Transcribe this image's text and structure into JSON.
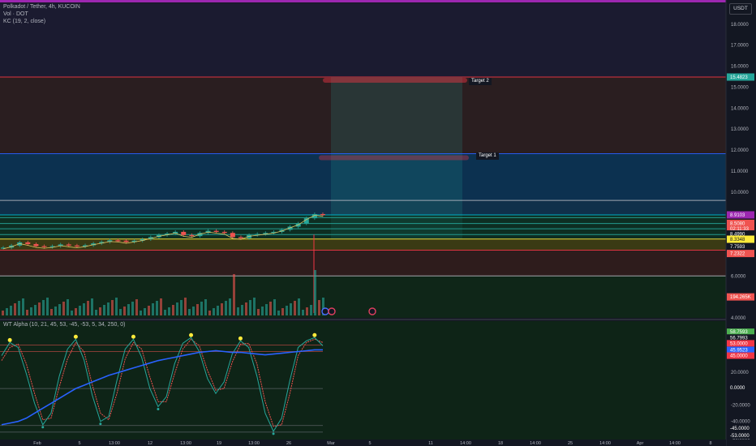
{
  "header": {
    "symbol_line": "Polkadot / Tether, 4h, KUCOIN",
    "volume_line": "Vol · DOT",
    "kc_line": "KC (19, 2, close)",
    "currency": "USDT"
  },
  "osc_legend": "WT Alpha (10, 21, 45, 53, -45, -53, 5, 34, 250, 0)",
  "targets": {
    "t2": "Target 2",
    "t1": "Target 1"
  },
  "colors": {
    "background": "#131722",
    "up": "#26a69a",
    "down": "#ef5350",
    "purple": "#9c27b0",
    "yellow": "#ffeb3b",
    "blue": "#2962ff",
    "cyan": "#00bcd4"
  },
  "chart_data": [
    {
      "type": "candlestick",
      "title": "Polkadot / Tether, 4h, KUCOIN",
      "ylim": [
        4.0,
        19.0
      ],
      "y_ticks": [
        "4.0000",
        "6.0000",
        "10.0000",
        "11.0000",
        "12.0000",
        "13.0000",
        "14.0000",
        "15.0000",
        "16.0000",
        "17.0000",
        "18.0000"
      ],
      "x_ticks": [
        "Feb",
        "5",
        "13:00",
        "12",
        "13:00",
        "19",
        "13:00",
        "26",
        "Mar",
        "5",
        "11",
        "14:00",
        "18",
        "14:00",
        "25",
        "14:00",
        "Apr",
        "14:00",
        "8"
      ],
      "price_labels": [
        {
          "text": "15.4823",
          "color": "#26a69a",
          "value": 15.4823
        },
        {
          "text": "8.9103",
          "color": "#9c27b0",
          "value": 8.9103
        },
        {
          "text": "8.5080",
          "color": "#ef5350",
          "value": 8.508
        },
        {
          "text": "02:11:33",
          "color": "#ef5350",
          "value": 8.25
        },
        {
          "text": "8.4990",
          "color": "#131722",
          "value": 8.0
        },
        {
          "text": "8.3348",
          "color": "#ffeb3b",
          "value": 7.75
        },
        {
          "text": "7.7593",
          "color": "#131722",
          "value": 7.4
        },
        {
          "text": "7.2322",
          "color": "#ef5350",
          "value": 7.07
        },
        {
          "text": "194.265K",
          "color": "#ef5350",
          "value": 5.0
        }
      ],
      "levels": [
        {
          "value": 15.48,
          "color": "#f23645"
        },
        {
          "value": 11.83,
          "color": "#2962ff"
        },
        {
          "value": 9.6,
          "color": "#b2b5be"
        },
        {
          "value": 8.91,
          "color": "#00bcd4"
        },
        {
          "value": 8.78,
          "color": "#26a69a"
        },
        {
          "value": 8.5,
          "color": "#26a69a"
        },
        {
          "value": 8.25,
          "color": "#26a69a"
        },
        {
          "value": 7.97,
          "color": "#26a69a"
        },
        {
          "value": 7.76,
          "color": "#ffeb3b"
        },
        {
          "value": 7.23,
          "color": "#f23645"
        },
        {
          "value": 6.0,
          "color": "#b2b5be"
        }
      ],
      "price_series": [
        7.35,
        7.45,
        7.6,
        7.52,
        7.42,
        7.38,
        7.42,
        7.5,
        7.45,
        7.4,
        7.46,
        7.55,
        7.62,
        7.7,
        7.68,
        7.62,
        7.68,
        7.75,
        7.85,
        7.95,
        8.02,
        8.1,
        7.95,
        7.9,
        8.05,
        8.15,
        8.1,
        8.05,
        7.85,
        7.8,
        7.95,
        8.0,
        8.05,
        8.1,
        8.2,
        8.35,
        8.5,
        8.75,
        8.95,
        8.9
      ]
    },
    {
      "type": "line",
      "title": "WT Alpha (10, 21, 45, 53, -45, -53, 5, 34, 250, 0)",
      "ylim": [
        -60,
        80
      ],
      "y_ticks": [
        "40.0000",
        "20.0000",
        "-20.0000",
        "-40.0000",
        "-60.0000"
      ],
      "value_labels": [
        {
          "text": "58.7593",
          "color": "#4caf50",
          "value": 69
        },
        {
          "text": "56.7993",
          "color": "#131722",
          "value": 62
        },
        {
          "text": "53.0000",
          "color": "#f23645",
          "value": 55
        },
        {
          "text": "45.9523",
          "color": "#2962ff",
          "value": 47
        },
        {
          "text": "45.0000",
          "color": "#f23645",
          "value": 40
        },
        {
          "text": "0.0000",
          "color": "#131722",
          "value": 1
        },
        {
          "text": "-45.0000",
          "color": "#131722",
          "value": -48
        },
        {
          "text": "-53.0000",
          "color": "#131722",
          "value": -57
        }
      ],
      "series": [
        {
          "values": [
            40,
            56,
            50,
            18,
            -18,
            -44,
            -30,
            15,
            48,
            60,
            35,
            -8,
            -40,
            -34,
            10,
            48,
            60,
            38,
            0,
            -22,
            -10,
            30,
            55,
            62,
            45,
            12,
            -6,
            8,
            42,
            58,
            50,
            15,
            -30,
            -52,
            -36,
            10,
            50,
            58,
            62,
            52
          ]
        },
        {
          "values": [
            34,
            50,
            54,
            30,
            -6,
            -38,
            -36,
            2,
            36,
            56,
            45,
            5,
            -30,
            -38,
            -6,
            36,
            56,
            48,
            14,
            -16,
            -16,
            18,
            48,
            60,
            52,
            22,
            -2,
            0,
            32,
            54,
            55,
            30,
            -16,
            -46,
            -44,
            -6,
            40,
            56,
            60,
            56
          ]
        },
        {
          "values": [
            -44,
            -42,
            -40,
            -36,
            -30,
            -24,
            -18,
            -12,
            -6,
            0,
            4,
            8,
            12,
            16,
            19,
            22,
            25,
            28,
            31,
            34,
            36,
            38,
            40,
            42,
            44,
            45,
            46,
            45,
            44,
            44,
            43,
            42,
            41,
            42,
            43,
            44,
            45,
            46,
            47,
            47
          ]
        }
      ]
    }
  ]
}
